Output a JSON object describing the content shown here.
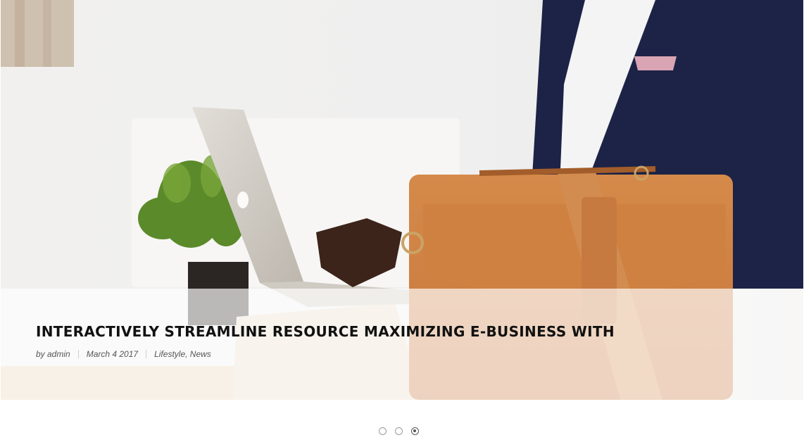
{
  "slider": {
    "active_index": 3,
    "slide_count": 3
  },
  "post": {
    "title": "INTERACTIVELY STREAMLINE RESOURCE MAXIMIZING E-BUSINESS WITH",
    "author": "by admin",
    "date": "March 4 2017",
    "category_1": "Lifestyle",
    "category_sep": ", ",
    "category_2": "News"
  },
  "colors": {
    "caption_bg": "#ffffffad",
    "title": "#111111",
    "meta": "#555555"
  }
}
